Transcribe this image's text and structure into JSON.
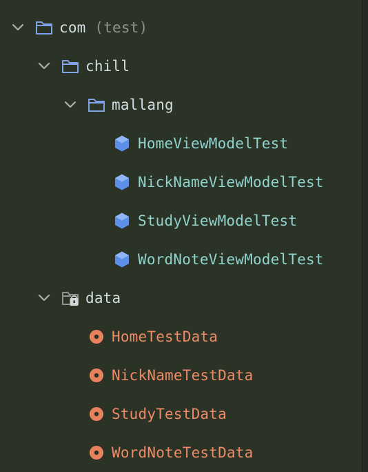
{
  "tree": {
    "root": {
      "name": "com",
      "hint": "(test)",
      "icon": "folder-icon",
      "expanded": true
    },
    "chill": {
      "name": "chill",
      "icon": "folder-icon",
      "expanded": true
    },
    "mallang": {
      "name": "mallang",
      "icon": "folder-icon",
      "expanded": true
    },
    "classes": [
      {
        "name": "HomeViewModelTest",
        "icon": "test-class-icon"
      },
      {
        "name": "NickNameViewModelTest",
        "icon": "test-class-icon"
      },
      {
        "name": "StudyViewModelTest",
        "icon": "test-class-icon"
      },
      {
        "name": "WordNoteViewModelTest",
        "icon": "test-class-icon"
      }
    ],
    "data": {
      "name": "data",
      "icon": "locked-folder-icon",
      "expanded": true
    },
    "objects": [
      {
        "name": "HomeTestData",
        "icon": "object-icon"
      },
      {
        "name": "NickNameTestData",
        "icon": "object-icon"
      },
      {
        "name": "StudyTestData",
        "icon": "object-icon"
      },
      {
        "name": "WordNoteTestData",
        "icon": "object-icon"
      }
    ]
  },
  "colors": {
    "background": "#2b3327",
    "package_text": "#d6dde0",
    "class_text": "#8fd3cc",
    "object_text": "#ee8a66",
    "hint_text": "#8d9391",
    "folder_icon": "#7fa3e6",
    "class_icon": "#5b8fe8",
    "object_icon": "#e8825e"
  }
}
